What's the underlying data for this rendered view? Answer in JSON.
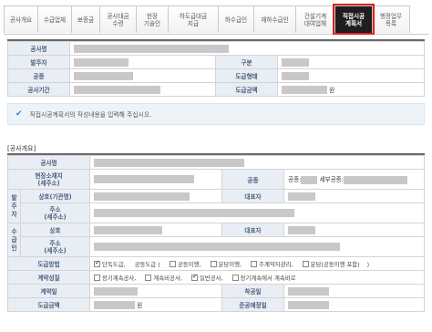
{
  "tabs": [
    {
      "label": "공사개요",
      "active": false
    },
    {
      "label": "수급업체",
      "active": false
    },
    {
      "label": "보증금",
      "active": false
    },
    {
      "label": "공사대금\n수령",
      "active": false
    },
    {
      "label": "현장\n기술인",
      "active": false
    },
    {
      "label": "하도급대금\n지급",
      "active": false
    },
    {
      "label": "하수급인",
      "active": false
    },
    {
      "label": "재하수급인",
      "active": false
    },
    {
      "label": "건설기계\n대여업체",
      "active": false
    },
    {
      "label": "직접시공\n계획서",
      "active": true
    },
    {
      "label": "행정업무\n목록",
      "active": false
    }
  ],
  "summary": {
    "project_name_label": "공사명",
    "client_label": "발주자",
    "division_label": "구분",
    "work_type_label": "공종",
    "subcontract_type_label": "도급형태",
    "period_label": "공사기간",
    "amount_label": "도급금액",
    "amount_unit": "원"
  },
  "notice": {
    "message": "직접시공계획서의 작성내용을 입력해 주십시오."
  },
  "overview": {
    "section_title": "[공사개요]",
    "project_name_label": "공사명",
    "site_location_label": "현장소재지\n(세주소)",
    "work_type_label": "공종",
    "work_type_value_prefix": "공종:",
    "work_type_value_mid": "세부공종:",
    "client_group_label": "발\n주\n자",
    "client_name_label": "상호(기관명)",
    "client_rep_label": "대표자",
    "client_addr_label": "주소\n(세주소)",
    "contractor_group_label": "수\n급\n인",
    "contractor_name_label": "상호",
    "contractor_rep_label": "대표자",
    "contractor_addr_label": "주소\n(세주소)",
    "contract_method_label": "도급방법",
    "contract_method_opts": [
      "단독도급,",
      "공동도급 (",
      "공동이행,",
      "분담이행,",
      "주계약자관리,",
      "분담(공동이행 포함)",
      ")"
    ],
    "contract_nature_label": "계약성질",
    "contract_nature_opts": [
      "장기계속공사,",
      "계속비공사,",
      "일반공사,",
      "장기계속에서 계속비로"
    ],
    "contract_date_label": "계약일",
    "start_date_label": "착공일",
    "contract_amount_label": "도급금액",
    "contract_amount_unit": "원",
    "completion_label": "준공예정일"
  }
}
